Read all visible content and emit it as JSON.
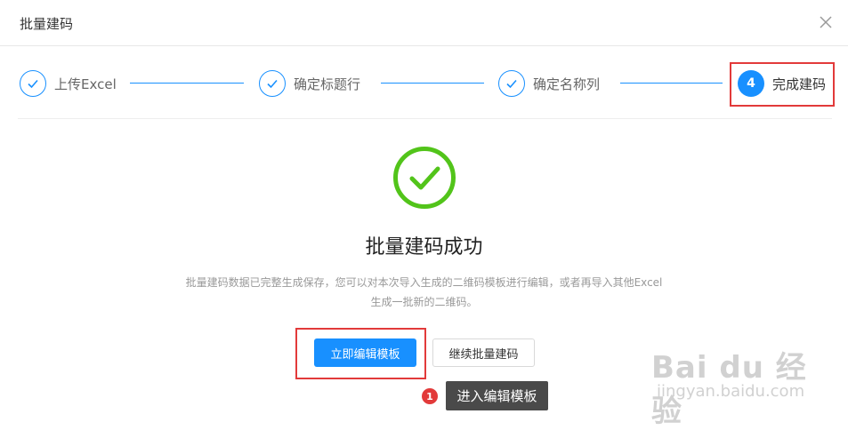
{
  "dialog": {
    "title": "批量建码",
    "close_icon": "close-icon"
  },
  "steps": [
    {
      "label": "上传Excel",
      "number": "",
      "status": "done",
      "icon": "check-icon"
    },
    {
      "label": "确定标题行",
      "number": "",
      "status": "done",
      "icon": "check-icon"
    },
    {
      "label": "确定名称列",
      "number": "",
      "status": "done",
      "icon": "check-icon"
    },
    {
      "label": "完成建码",
      "number": "4",
      "status": "current",
      "icon": ""
    }
  ],
  "colors": {
    "primary": "#1890ff",
    "success": "#52c41a",
    "highlight": "#e23a3a",
    "tooltip_bg": "#4a4a4a"
  },
  "result": {
    "icon": "success-check-circle-icon",
    "title": "批量建码成功",
    "description_line1": "批量建码数据已完整生成保存，您可以对本次导入生成的二维码模板进行编辑，或者再导入其他Excel",
    "description_line2": "生成一批新的二维码。"
  },
  "actions": {
    "primary_label": "立即编辑模板",
    "secondary_label": "继续批量建码"
  },
  "annotation": {
    "number": "1",
    "text": "进入编辑模板"
  },
  "watermark": {
    "main": "Bai du 经验",
    "sub": "jingyan.baidu.com"
  }
}
